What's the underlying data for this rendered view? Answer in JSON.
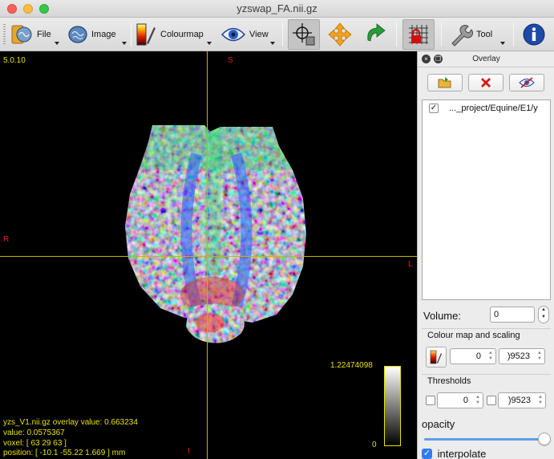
{
  "window": {
    "title": "yzswap_FA.nii.gz"
  },
  "toolbar": {
    "file_label": "File",
    "image_label": "Image",
    "colourmap_label": "Colourmap",
    "view_label": "View",
    "tool_label": "Tool"
  },
  "viewer": {
    "version": "5.0.10",
    "orient_superior": "S",
    "orient_right": "R",
    "orient_left": "L",
    "orient_inferior": "I",
    "colorbar_max": "1.22474098",
    "colorbar_min": "0",
    "info": {
      "overlay_line": "yzs_V1.nii.gz overlay value: 0.663234",
      "value_line": "value: 0.0575367",
      "voxel_line": "voxel: [ 63 29 63 ]",
      "position_line": "position: [ -10.1 -55.22 1.669 ] mm"
    }
  },
  "panel": {
    "title": "Overlay",
    "overlay_item": "..._project/Equine/E1/y",
    "volume_label": "Volume:",
    "volume_value": "0",
    "colourmap_group": "Colour map and scaling",
    "scale_min": "0",
    "scale_max": ")9523",
    "thresholds_group": "Thresholds",
    "thresh_min": "0",
    "thresh_max": ")9523",
    "opacity_label": "opacity",
    "opacity_level": 0.95,
    "interpolate_label": "interpolate"
  }
}
